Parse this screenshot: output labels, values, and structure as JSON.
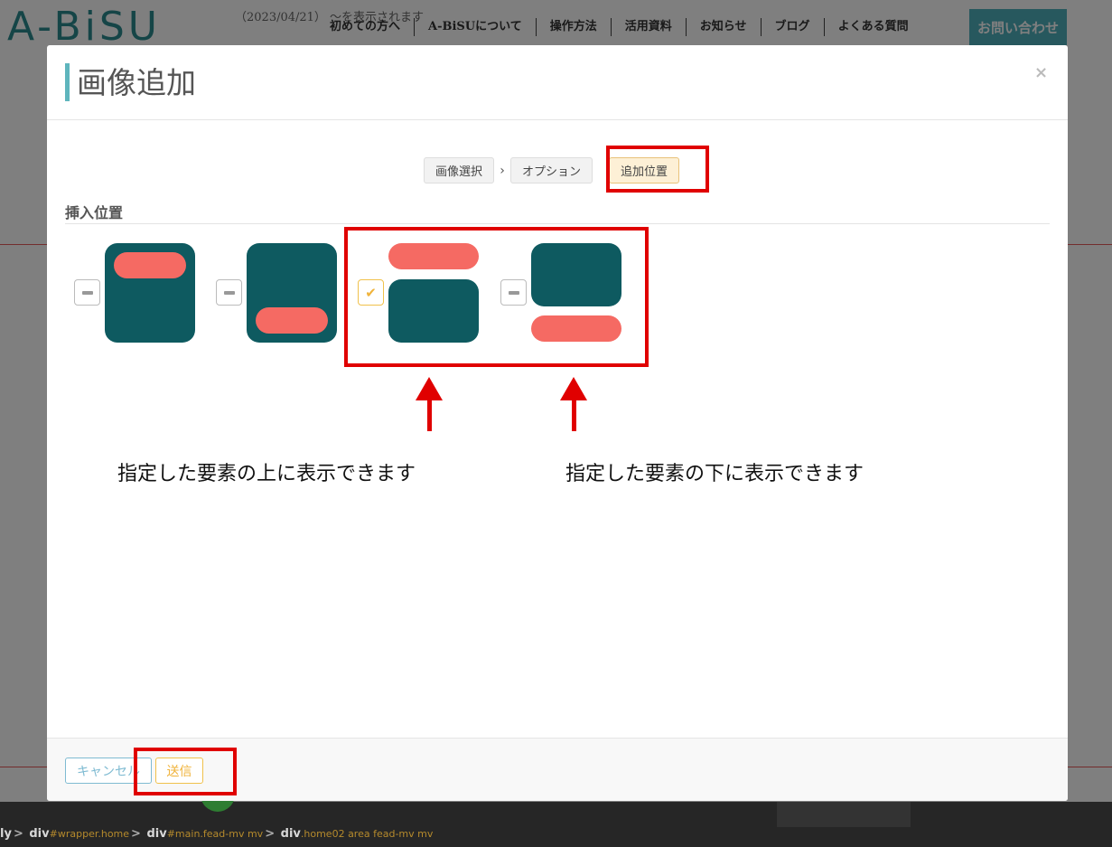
{
  "background_page": {
    "logo": "A-BiSU",
    "notice": "（2023/04/21）   〜を表示されます",
    "nav": [
      "初めての方へ",
      "A-BiSUについて",
      "操作方法",
      "活用資料",
      "お知らせ",
      "ブログ",
      "よくある質問"
    ],
    "contact_button": "お問い合わせ"
  },
  "devtools": {
    "breadcrumb": [
      {
        "tag": "ly",
        "cls": ""
      },
      {
        "tag": "div",
        "cls": "#wrapper.home"
      },
      {
        "tag": "div",
        "cls": "#main.fead-mv mv"
      },
      {
        "tag": "div",
        "cls": ".home02 area fead-mv mv"
      }
    ]
  },
  "modal": {
    "title": "画像追加",
    "close_glyph": "×",
    "steps": [
      "画像選択",
      "オプション",
      "追加位置"
    ],
    "step_separator": "›",
    "section_title": "挿入位置",
    "options": [
      {
        "checked": false
      },
      {
        "checked": false
      },
      {
        "checked": true
      },
      {
        "checked": false
      }
    ],
    "check_glyph": "✔",
    "footer": {
      "cancel_label": "キャンセル",
      "submit_label": "送信"
    }
  },
  "annotations": {
    "above_text": "指定した要素の上に表示できます",
    "below_text": "指定した要素の下に表示できます",
    "color": "#e00000"
  },
  "colors": {
    "tile": "#0e5a60",
    "pill": "#f56a63",
    "accent": "#5fb5bd",
    "checked": "#f0b33b"
  }
}
